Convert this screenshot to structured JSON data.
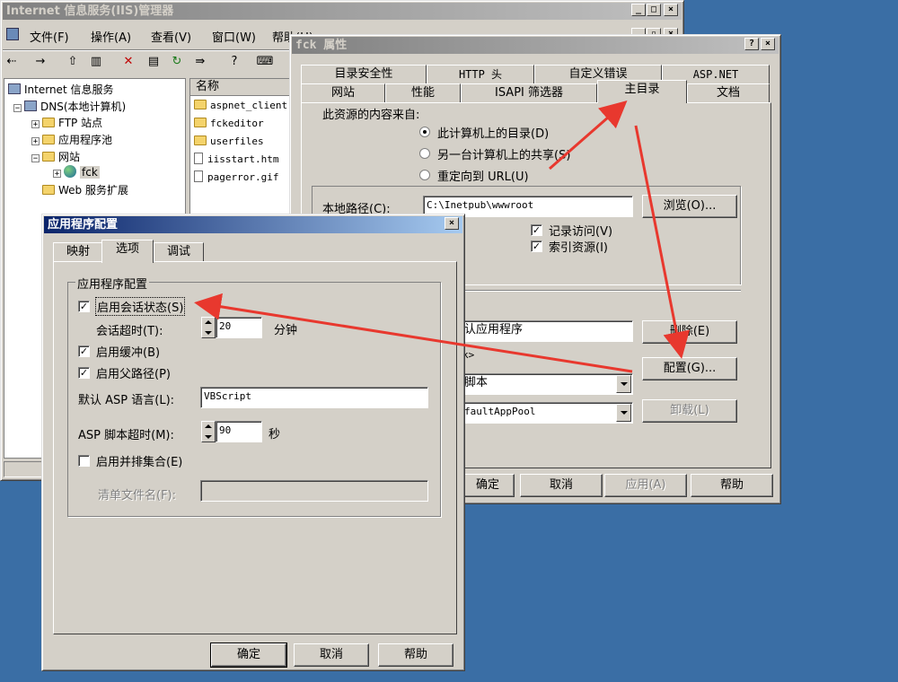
{
  "iis": {
    "title": "Internet 信息服务(IIS)管理器",
    "menu": [
      "文件(F)",
      "操作(A)",
      "查看(V)",
      "窗口(W)",
      "帮助(H)"
    ],
    "tree": {
      "root": "Internet 信息服务",
      "computer": "DNS(本地计算机)",
      "ftp": "FTP 站点",
      "apppool": "应用程序池",
      "websites": "网站",
      "fck": "fck",
      "webext": "Web 服务扩展"
    },
    "list_header": "名称",
    "files": [
      "aspnet_client",
      "fckeditor",
      "userfiles",
      "iisstart.htm",
      "pagerror.gif"
    ]
  },
  "props": {
    "title": "fck 属性",
    "tabs_row1": [
      "目录安全性",
      "HTTP 头",
      "自定义错误",
      "ASP.NET"
    ],
    "tabs_row2": [
      "网站",
      "性能",
      "ISAPI 筛选器",
      "主目录",
      "文档"
    ],
    "source_label": "此资源的内容来自:",
    "radio1": "此计算机上的目录(D)",
    "radio2": "另一台计算机上的共享(S)",
    "radio3": "重定向到 URL(U)",
    "local_path_label": "本地路径(C):",
    "local_path": "C:\\Inetpub\\wwwroot",
    "browse": "浏览(O)...",
    "log_visits": "记录访问(V)",
    "index_resource": "索引资源(I)",
    "app_name": "认应用程序",
    "start_point": "k>",
    "exec_perm": "脚本",
    "app_pool": "faultAppPool",
    "remove": "删除(E)",
    "configure": "配置(G)...",
    "unload": "卸载(L)",
    "ok": "确定",
    "cancel": "取消",
    "apply": "应用(A)",
    "help": "帮助"
  },
  "appcfg": {
    "title": "应用程序配置",
    "tabs": [
      "映射",
      "选项",
      "调试"
    ],
    "group_title": "应用程序配置",
    "enable_session": "启用会话状态(S)",
    "session_timeout_label": "会话超时(T):",
    "session_timeout": "20",
    "minutes": "分钟",
    "enable_buffer": "启用缓冲(B)",
    "enable_parent_paths": "启用父路径(P)",
    "default_lang_label": "默认 ASP 语言(L):",
    "default_lang": "VBScript",
    "script_timeout_label": "ASP 脚本超时(M):",
    "script_timeout": "90",
    "seconds": "秒",
    "enable_side_by_side": "启用并排集合(E)",
    "manifest_label": "清单文件名(F):",
    "ok": "确定",
    "cancel": "取消",
    "help": "帮助"
  },
  "colors": {
    "desktop": "#3a6ea5",
    "title_active": "#0a246a",
    "arrow": "#e8382e"
  }
}
